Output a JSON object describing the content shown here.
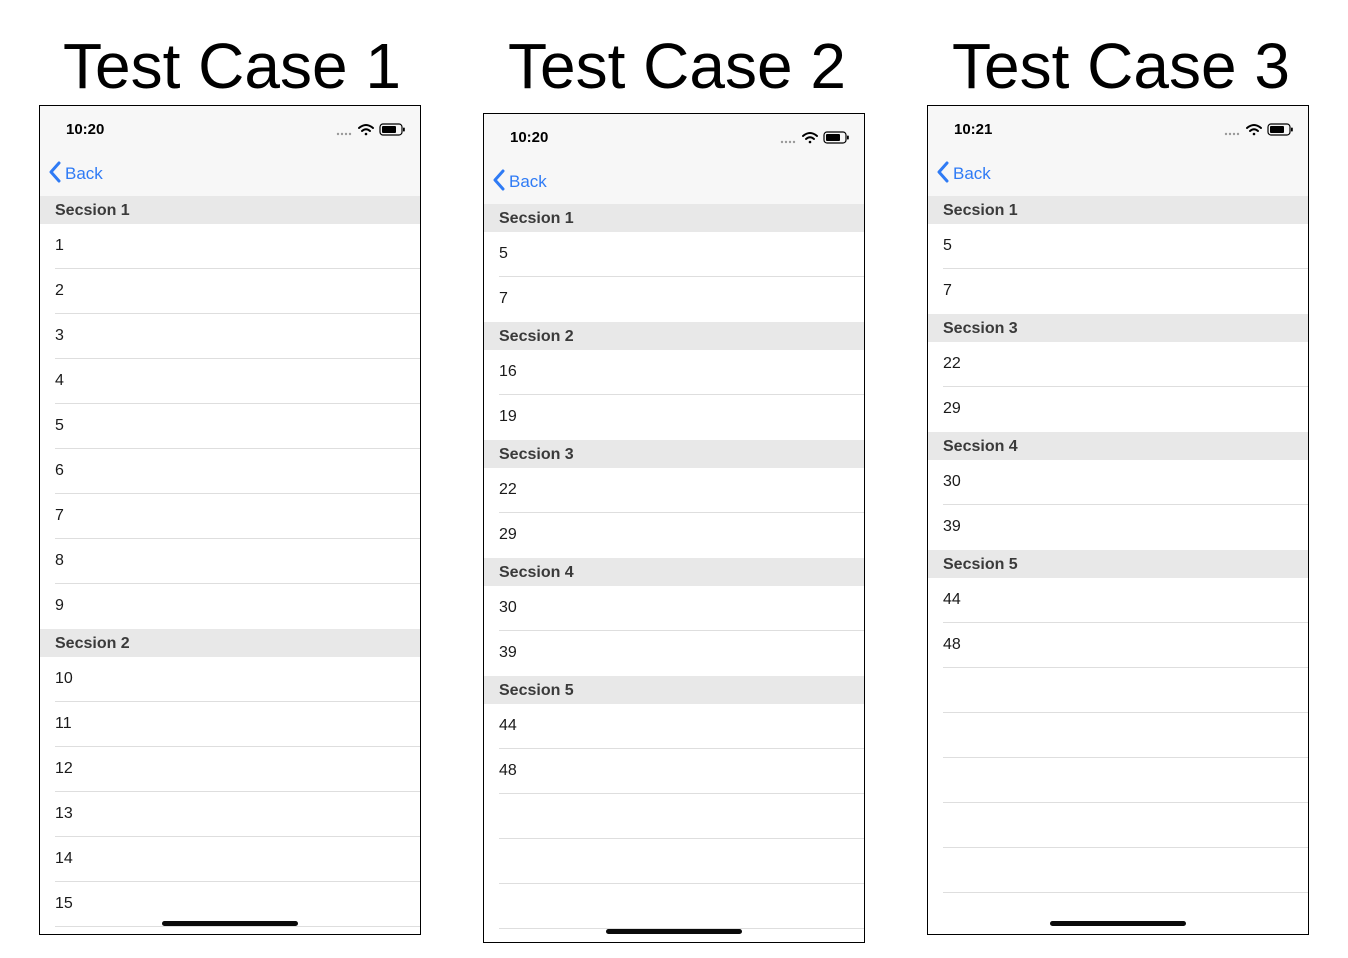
{
  "cases": [
    {
      "title": "Test Case 1",
      "time": "10:20",
      "back_label": "Back",
      "sections": [
        {
          "header": "Secsion 1",
          "rows": [
            "1",
            "2",
            "3",
            "4",
            "5",
            "6",
            "7",
            "8",
            "9"
          ]
        },
        {
          "header": "Secsion 2",
          "rows": [
            "10",
            "11",
            "12",
            "13",
            "14",
            "15"
          ]
        }
      ],
      "empty_rows": 0
    },
    {
      "title": "Test Case 2",
      "time": "10:20",
      "back_label": "Back",
      "sections": [
        {
          "header": "Secsion 1",
          "rows": [
            "5",
            "7"
          ]
        },
        {
          "header": "Secsion 2",
          "rows": [
            "16",
            "19"
          ]
        },
        {
          "header": "Secsion 3",
          "rows": [
            "22",
            "29"
          ]
        },
        {
          "header": "Secsion 4",
          "rows": [
            "30",
            "39"
          ]
        },
        {
          "header": "Secsion 5",
          "rows": [
            "44",
            "48"
          ]
        }
      ],
      "empty_rows": 3
    },
    {
      "title": "Test Case 3",
      "time": "10:21",
      "back_label": "Back",
      "sections": [
        {
          "header": "Secsion 1",
          "rows": [
            "5",
            "7"
          ]
        },
        {
          "header": "Secsion 3",
          "rows": [
            "22",
            "29"
          ]
        },
        {
          "header": "Secsion 4",
          "rows": [
            "30",
            "39"
          ]
        },
        {
          "header": "Secsion 5",
          "rows": [
            "44",
            "48"
          ]
        }
      ],
      "empty_rows": 5
    }
  ],
  "icons": {
    "cellular": "cellular-dots-icon",
    "wifi": "wifi-icon",
    "battery": "battery-icon",
    "back": "chevron-left-icon"
  },
  "colors": {
    "accent": "#2f7bf5",
    "section_header_bg": "#e8e8e8",
    "nav_bg": "#f7f7f7"
  }
}
